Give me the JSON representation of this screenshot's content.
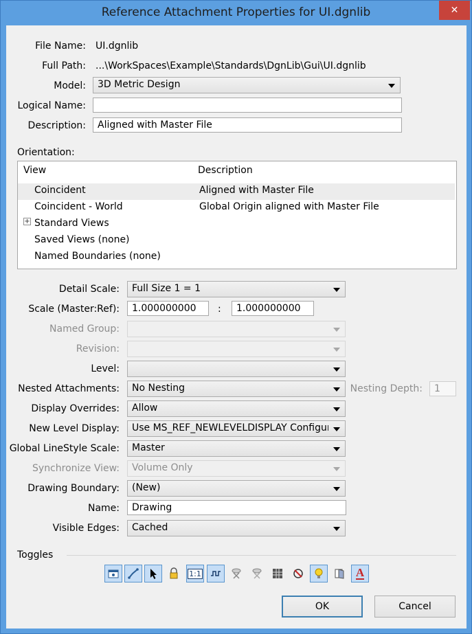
{
  "window": {
    "title": "Reference Attachment Properties for UI.dgnlib",
    "close_glyph": "✕"
  },
  "file": {
    "file_name_label": "File Name:",
    "file_name": "UI.dgnlib",
    "full_path_label": "Full Path:",
    "full_path": "...\\WorkSpaces\\Example\\Standards\\DgnLib\\Gui\\UI.dgnlib",
    "model_label": "Model:",
    "model_value": "3D Metric Design",
    "logical_name_label": "Logical Name:",
    "logical_name_value": "",
    "description_label": "Description:",
    "description_value": "Aligned with Master File"
  },
  "orientation": {
    "label": "Orientation:",
    "columns": [
      "View",
      "Description"
    ],
    "rows": [
      {
        "view": "Coincident",
        "description": "Aligned with Master File"
      },
      {
        "view": "Coincident - World",
        "description": "Global Origin aligned with Master File"
      },
      {
        "view": "Standard Views",
        "description": "",
        "expander": "+"
      },
      {
        "view": "Saved Views (none)",
        "description": ""
      },
      {
        "view": "Named Boundaries (none)",
        "description": ""
      }
    ]
  },
  "props": {
    "detail_scale_label": "Detail Scale:",
    "detail_scale": "Full Size 1 = 1",
    "scale_label": "Scale (Master:Ref):",
    "scale_master": "1.000000000",
    "scale_sep": ":",
    "scale_ref": "1.000000000",
    "named_group_label": "Named Group:",
    "named_group": "",
    "revision_label": "Revision:",
    "revision": "",
    "level_label": "Level:",
    "level": "",
    "nested_label": "Nested Attachments:",
    "nested": "No Nesting",
    "nesting_depth_label": "Nesting Depth:",
    "nesting_depth": "1",
    "display_overrides_label": "Display Overrides:",
    "display_overrides": "Allow",
    "new_level_label": "New Level Display:",
    "new_level": "Use MS_REF_NEWLEVELDISPLAY Configuration",
    "linestyle_label": "Global LineStyle Scale:",
    "linestyle": "Master",
    "sync_label": "Synchronize View:",
    "sync": "Volume Only",
    "boundary_label": "Drawing Boundary:",
    "boundary": "(New)",
    "name_label": "Name:",
    "name": "Drawing",
    "edges_label": "Visible Edges:",
    "edges": "Cached"
  },
  "toggles": {
    "label": "Toggles",
    "items": [
      {
        "icon": "display-icon",
        "active": true
      },
      {
        "icon": "snap-icon",
        "active": true
      },
      {
        "icon": "locate-icon",
        "active": true
      },
      {
        "icon": "lock-icon",
        "active": false
      },
      {
        "icon": "true-scale-icon",
        "active": true,
        "text": "1:1"
      },
      {
        "icon": "scale-linestyles-icon",
        "active": true
      },
      {
        "icon": "ignore-attachment-icon",
        "active": false
      },
      {
        "icon": "treat-as-element-icon",
        "active": false
      },
      {
        "icon": "raster-icon",
        "active": false
      },
      {
        "icon": "display-raster-icon",
        "active": false
      },
      {
        "icon": "use-lights-icon",
        "active": true
      },
      {
        "icon": "ignore-elevation-icon",
        "active": false
      },
      {
        "icon": "annotation-scale-icon",
        "active": true,
        "text": "A"
      }
    ]
  },
  "buttons": {
    "ok": "OK",
    "cancel": "Cancel"
  },
  "colors": {
    "title_bar": "#5c9fe0",
    "close": "#c7433b",
    "dialog_bg": "#f0f0f0",
    "toggle_on": "#c5ddf6"
  }
}
